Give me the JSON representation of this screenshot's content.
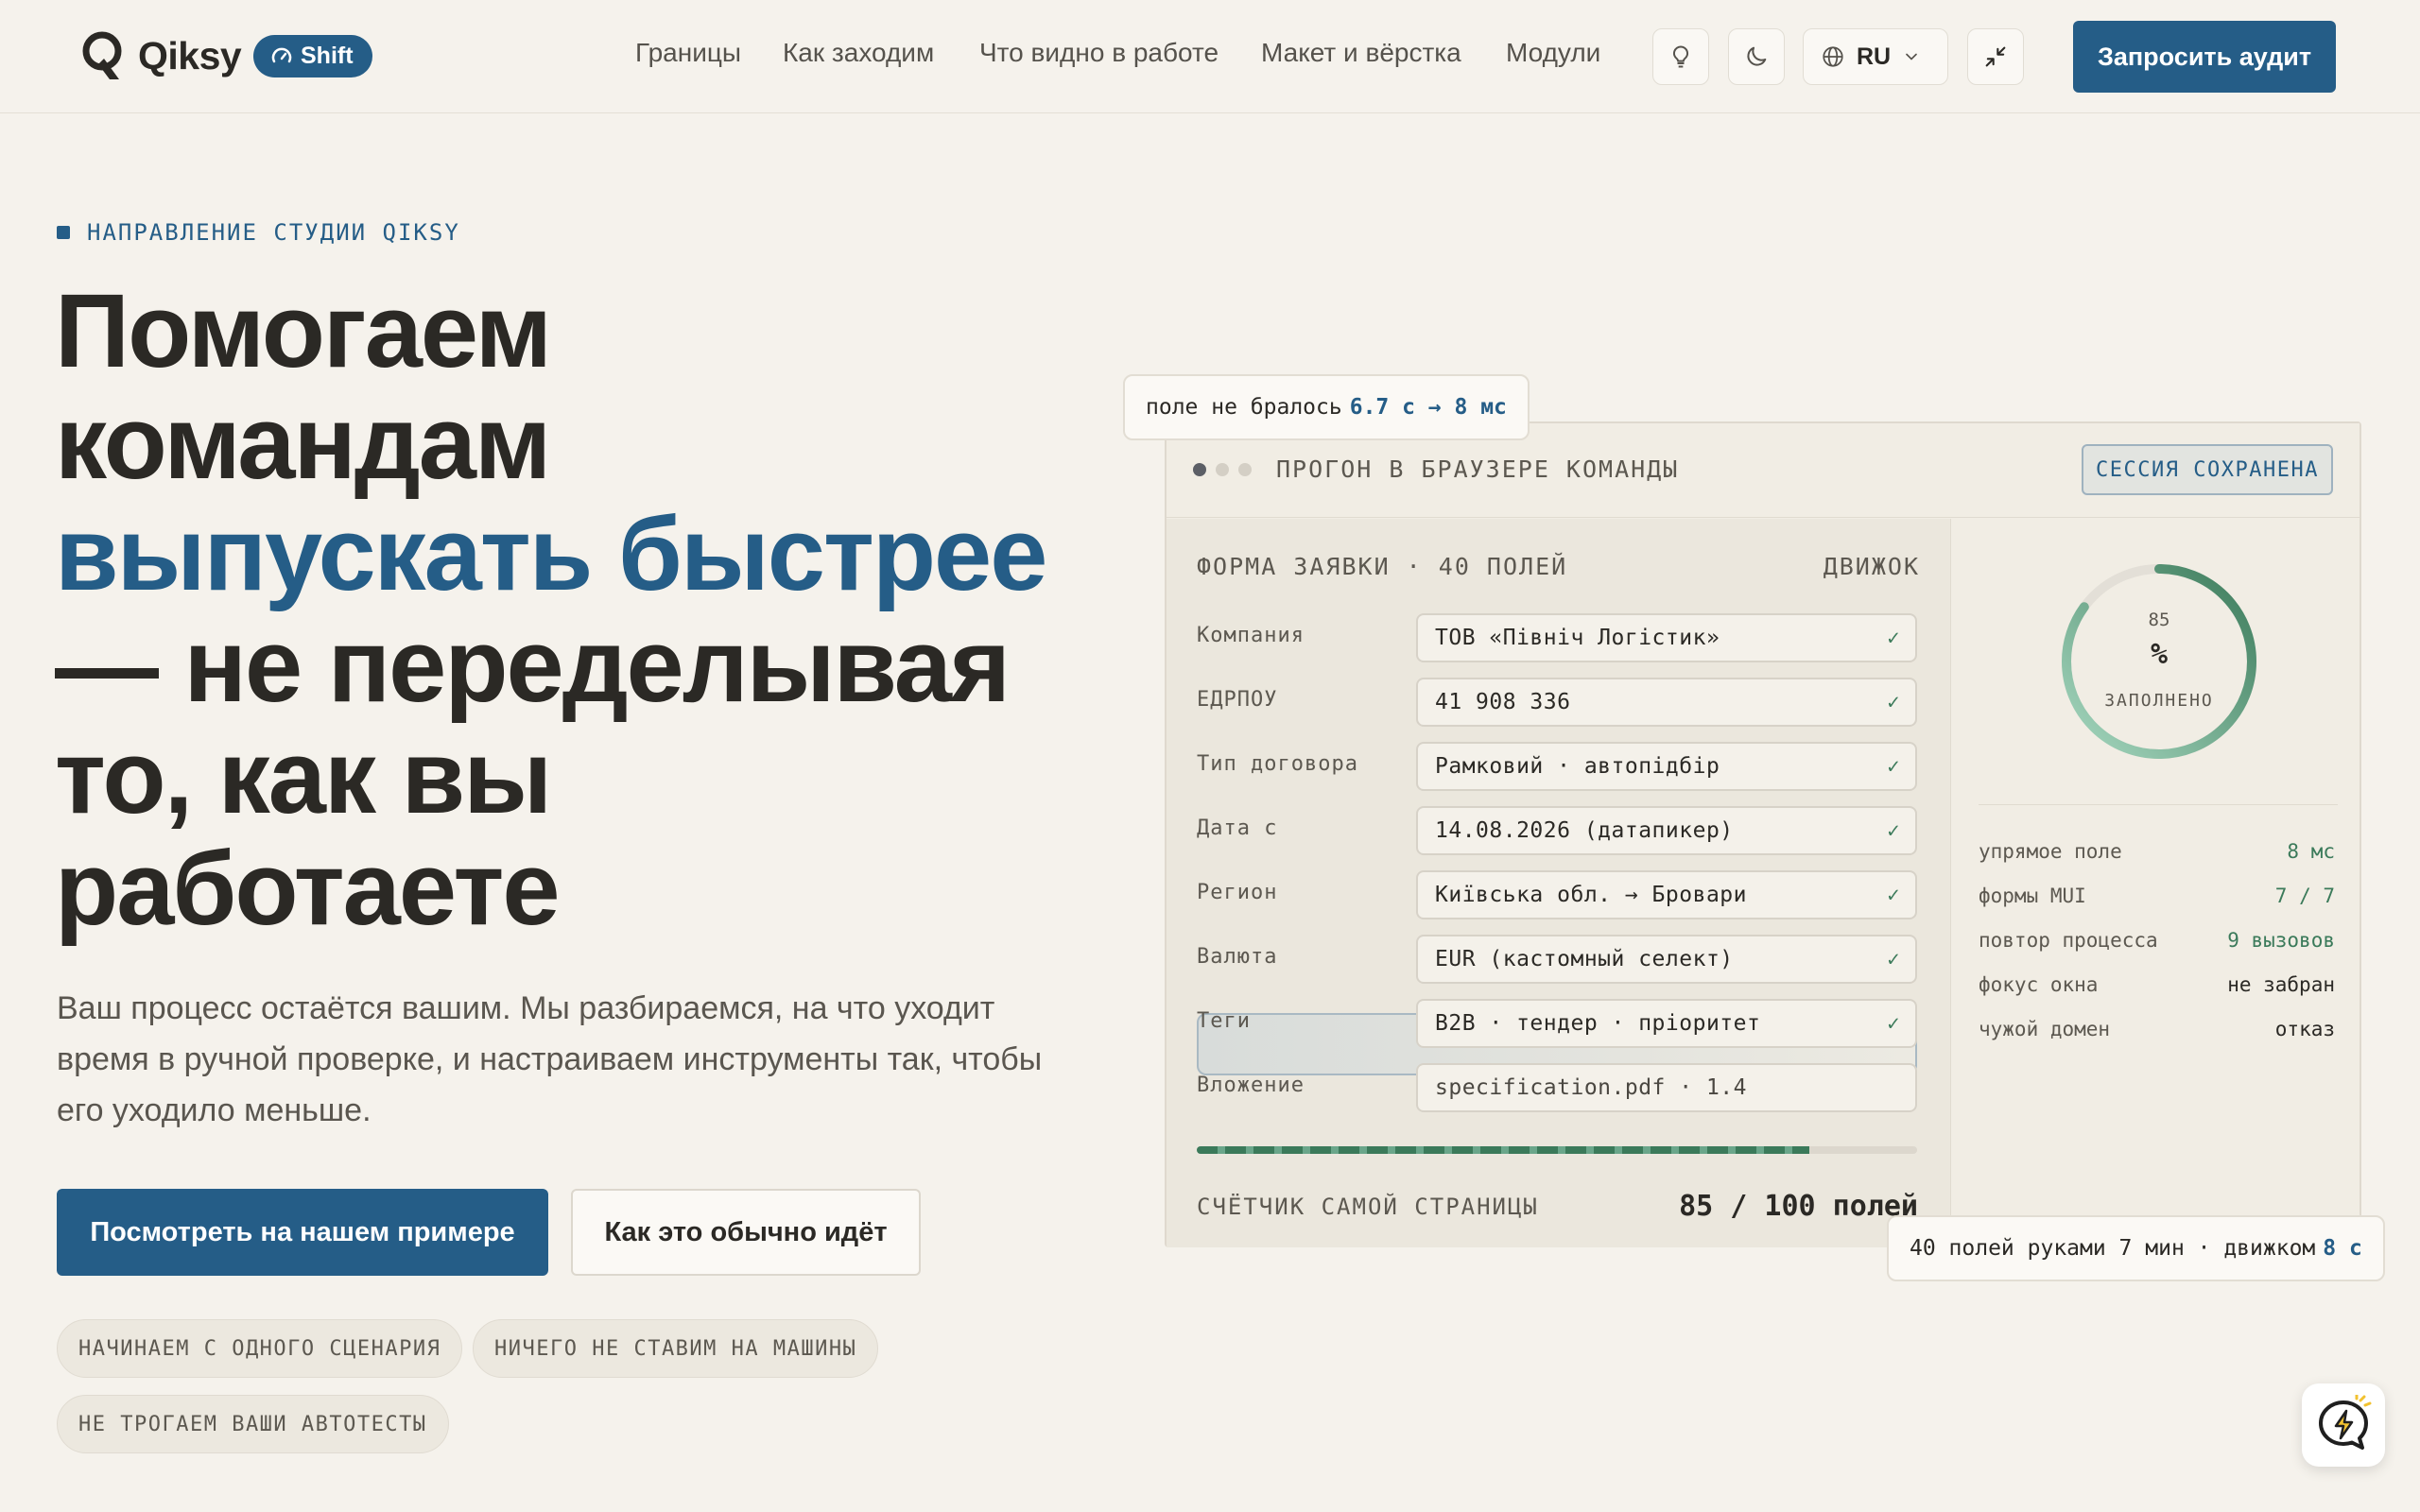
{
  "header": {
    "brand": "Qiksy",
    "badge": "Shift",
    "nav": [
      "Границы",
      "Как заходим",
      "Что видно в работе",
      "Макет и вёрстка",
      "Модули"
    ],
    "lang": "RU",
    "cta": "Запросить аудит",
    "icons": [
      "lightbulb-icon",
      "moon-icon",
      "globe-icon",
      "chevron-down-icon",
      "collapse-icon"
    ]
  },
  "hero": {
    "eyebrow": "НАПРАВЛЕНИЕ СТУДИИ QIKSY",
    "headline": {
      "line1": "Помогаем",
      "line2": "командам",
      "line3_accent": "выпускать быстрее",
      "line4": "— не переделывая",
      "line5": "то, как вы",
      "line6": "работаете"
    },
    "lead": "Ваш процесс остаётся вашим. Мы разбираемся, на что уходит время в ручной проверке, и настраиваем инструменты так, чтобы его уходило меньше.",
    "primary_button": "Посмотреть на нашем примере",
    "secondary_button": "Как это обычно идёт",
    "chips": [
      "НАЧИНАЕМ С ОДНОГО СЦЕНАРИЯ",
      "НИЧЕГО НЕ СТАВИМ НА МАШИНЫ",
      "НЕ ТРОГАЕМ ВАШИ АВТОТЕСТЫ"
    ]
  },
  "demo": {
    "note_top": {
      "text": "поле не бралось",
      "value": "6.7 с → 8 мс"
    },
    "panel_title": "ПРОГОН В БРАУЗЕРЕ КОМАНДЫ",
    "session_badge": "СЕССИЯ СОХРАНЕНА",
    "form_title": "ФОРМА ЗАЯВКИ · 40 ПОЛЕЙ",
    "form_engine": "ДВИЖОК",
    "rows": [
      {
        "label": "Компания",
        "value": "ТОВ «Північ Логістик»",
        "check": "✓"
      },
      {
        "label": "ЕДРПОУ",
        "value": "41 908 336",
        "check": "✓"
      },
      {
        "label": "Тип договора",
        "value": "Рамковий · автопідбір",
        "check": "✓"
      },
      {
        "label": "Дата с",
        "value": "14.08.2026 (датапикер)",
        "check": "✓"
      },
      {
        "label": "Регион",
        "value": "Київська обл. → Бровари",
        "check": "✓"
      },
      {
        "label": "Валюта",
        "value": "EUR (кастомный селект)",
        "check": "✓"
      },
      {
        "label": "Теги",
        "value": "B2B · тендер · пріоритет",
        "check": "✓"
      },
      {
        "label": "Вложение",
        "value": "specification.pdf · 1.4",
        "check": ""
      }
    ],
    "progress": 0.85,
    "counter_label": "СЧЁТЧИК САМОЙ СТРАНИЦЫ",
    "counter_value": "85 / 100 полей",
    "gauge": {
      "value": "85",
      "unit": "%",
      "caption": "ЗАПОЛНЕНО",
      "fraction": 0.85
    },
    "stats": [
      {
        "key": "упрямое поле",
        "value": "8 мс",
        "color": "#3b7a5a"
      },
      {
        "key": "формы MUI",
        "value": "7 / 7",
        "color": "#3b7a5a"
      },
      {
        "key": "повтор процесса",
        "value": "9 вызовов",
        "color": "#3b7a5a"
      },
      {
        "key": "фокус окна",
        "value": "не забран",
        "color": "#2b2925"
      },
      {
        "key": "чужой домен",
        "value": "отказ",
        "color": "#2b2925"
      }
    ],
    "note_bottom": {
      "text": "40 полей руками 7 мин · движком",
      "value": "8 с"
    }
  },
  "colors": {
    "accent": "#255d87",
    "success": "#3b7a5a",
    "background": "#f5f2ec"
  }
}
